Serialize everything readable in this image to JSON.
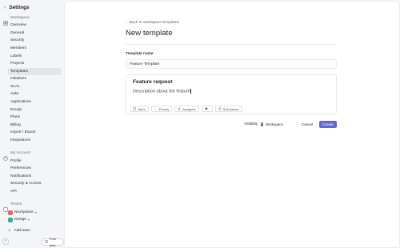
{
  "sidebar": {
    "back_icon": "chevron-left-icon",
    "title": "Settings",
    "workspace_section": "Workspace",
    "workspace_items": [
      {
        "label": "Overview"
      },
      {
        "label": "General"
      },
      {
        "label": "Security"
      },
      {
        "label": "Members"
      },
      {
        "label": "Labels"
      },
      {
        "label": "Projects"
      },
      {
        "label": "Templates",
        "active": true
      },
      {
        "label": "Initiatives"
      },
      {
        "label": "SLAs"
      },
      {
        "label": "Asks"
      },
      {
        "label": "Applications"
      },
      {
        "label": "Emojis"
      },
      {
        "label": "Plans"
      },
      {
        "label": "Billing"
      },
      {
        "label": "Import / Export"
      },
      {
        "label": "Integrations"
      }
    ],
    "account_section": "My Account",
    "account_items": [
      {
        "label": "Profile"
      },
      {
        "label": "Preferences"
      },
      {
        "label": "Notifications"
      },
      {
        "label": "Security & Access"
      },
      {
        "label": "API"
      }
    ],
    "teams_section": "Teams",
    "teams": [
      {
        "label": "Nicelydone",
        "color": "#e06a62"
      },
      {
        "label": "Design",
        "color": "#3ea8a1"
      }
    ],
    "add_team": "Add team",
    "help": "?",
    "free_plan": "Free plan"
  },
  "main": {
    "back_link": "Back to workspace templates",
    "page_title": "New template",
    "template_name_label": "Template name",
    "template_name_value": "Feature Template",
    "editor": {
      "title": "Feature request",
      "description": "Description about the feature"
    },
    "chips": [
      {
        "label": "Team",
        "icon": "team-icon"
      },
      {
        "label": "Priority",
        "icon": "priority-icon"
      },
      {
        "label": "Assignee",
        "icon": "person-icon"
      },
      {
        "label": "",
        "icon": "tag-icon"
      },
      {
        "label": "Sub-issues",
        "icon": "subissue-icon"
      }
    ],
    "visibility_label": "Visibility",
    "visibility_value": "Workspace",
    "cancel_label": "Cancel",
    "create_label": "Create"
  },
  "colors": {
    "accent": "#5e6ad2",
    "sidebar_bg": "#f4f5f8",
    "active_item": "#e4e5e9"
  }
}
